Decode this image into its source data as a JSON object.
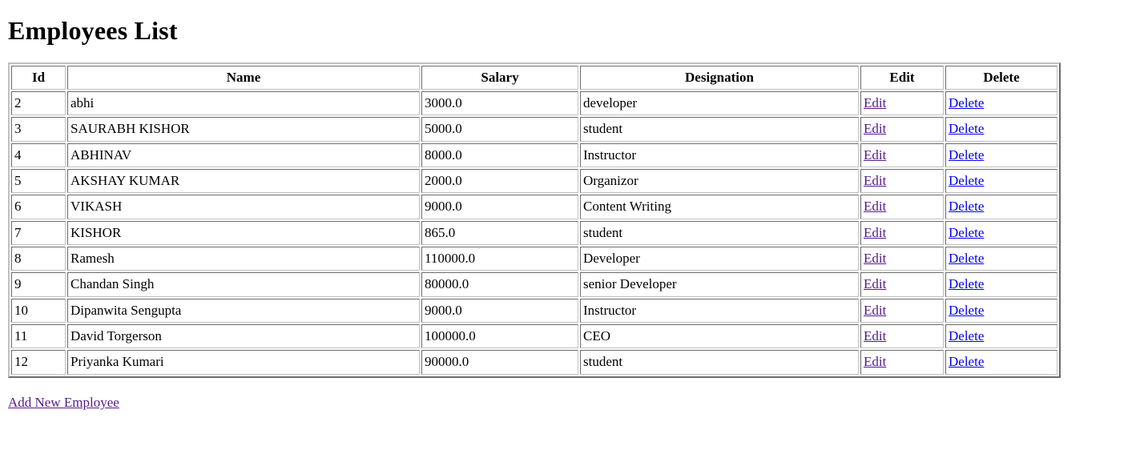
{
  "page": {
    "title": "Employees List"
  },
  "table": {
    "columns": [
      "Id",
      "Name",
      "Salary",
      "Designation",
      "Edit",
      "Delete"
    ],
    "rows": [
      {
        "id": "2",
        "name": "abhi",
        "salary": "3000.0",
        "designation": "developer",
        "edit": "Edit",
        "delete": "Delete"
      },
      {
        "id": "3",
        "name": "SAURABH KISHOR",
        "salary": "5000.0",
        "designation": "student",
        "edit": "Edit",
        "delete": "Delete"
      },
      {
        "id": "4",
        "name": "ABHINAV",
        "salary": "8000.0",
        "designation": "Instructor",
        "edit": "Edit",
        "delete": "Delete"
      },
      {
        "id": "5",
        "name": "AKSHAY KUMAR",
        "salary": "2000.0",
        "designation": "Organizor",
        "edit": "Edit",
        "delete": "Delete"
      },
      {
        "id": "6",
        "name": "VIKASH",
        "salary": "9000.0",
        "designation": "Content Writing",
        "edit": "Edit",
        "delete": "Delete"
      },
      {
        "id": "7",
        "name": "KISHOR",
        "salary": "865.0",
        "designation": "student",
        "edit": "Edit",
        "delete": "Delete"
      },
      {
        "id": "8",
        "name": "Ramesh",
        "salary": "110000.0",
        "designation": "Developer",
        "edit": "Edit",
        "delete": "Delete"
      },
      {
        "id": "9",
        "name": "Chandan Singh",
        "salary": "80000.0",
        "designation": "senior Developer",
        "edit": "Edit",
        "delete": "Delete"
      },
      {
        "id": "10",
        "name": "Dipanwita Sengupta",
        "salary": "9000.0",
        "designation": "Instructor",
        "edit": "Edit",
        "delete": "Delete"
      },
      {
        "id": "11",
        "name": "David Torgerson",
        "salary": "100000.0",
        "designation": "CEO",
        "edit": "Edit",
        "delete": "Delete"
      },
      {
        "id": "12",
        "name": "Priyanka Kumari",
        "salary": "90000.0",
        "designation": "student",
        "edit": "Edit",
        "delete": "Delete"
      }
    ]
  },
  "footer": {
    "add_new_label": "Add New Employee"
  },
  "colors": {
    "link_visited": "#551a8b",
    "link_unvisited": "#0000ee",
    "text": "#000000",
    "table_border": "#c0c0c0",
    "background": "#ffffff"
  }
}
